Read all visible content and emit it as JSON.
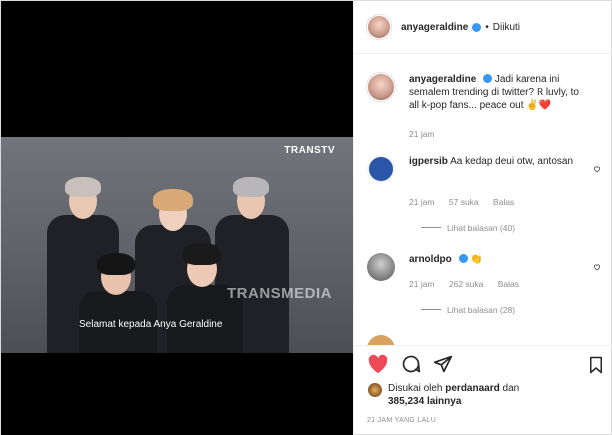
{
  "header": {
    "username": "anyageraldine",
    "separator": "•",
    "follow_status": "Diikuti"
  },
  "video": {
    "channel_logo": "TRANSTV",
    "watermark": "TRANSMEDIA",
    "subtitle": "Selamat kepada Anya Geraldine"
  },
  "caption": {
    "username": "anyageraldine",
    "text": "Jadi karena ini semalem trending di twitter? 𝈖 luvly, to all k-pop fans... peace out ✌️❤️",
    "time": "21 jam"
  },
  "comments": [
    {
      "username": "igpersib",
      "text": "Aa kedap deui otw, antosan",
      "time": "21 jam",
      "likes": "57 suka",
      "reply": "Balas",
      "view_replies": "Lihat balasan (40)"
    },
    {
      "username": "arnoldpo",
      "text": "👏",
      "time": "21 jam",
      "likes": "262 suka",
      "reply": "Balas",
      "view_replies": "Lihat balasan (28)"
    }
  ],
  "likes_summary": {
    "prefix": "Disukai oleh",
    "user": "perdanaard",
    "middle": "dan",
    "count": "385,234",
    "suffix": "lainnya"
  },
  "timestamp": "21 JAM YANG LALU",
  "icons": {
    "like": "heart-icon",
    "comment": "comment-icon",
    "share": "share-icon",
    "save": "bookmark-icon"
  },
  "colors": {
    "like_red": "#ed4956",
    "verified_blue": "#3897f0"
  }
}
